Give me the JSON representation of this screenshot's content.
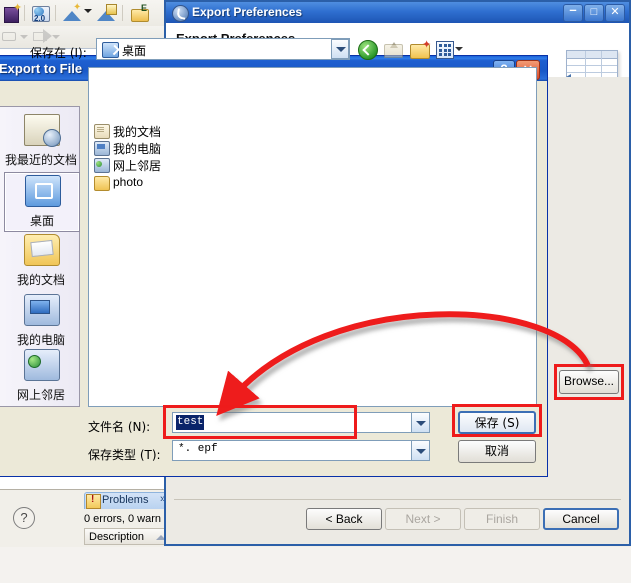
{
  "workbench": {
    "toolbar_icons": [
      "new-wizard-icon",
      "web-browser-icon",
      "new-java-project-icon",
      "new-class-icon",
      "open-type-icon"
    ],
    "nav_icons": [
      "back-arrow-icon",
      "forward-arrow-icon"
    ]
  },
  "problems_view": {
    "tab_label": "Problems",
    "tab_icon": "problems-warning-icon",
    "chevron": "»",
    "summary": "0 errors, 0 warn",
    "column_header": "Description",
    "sort_indicator": "sort-ascending-icon"
  },
  "wizard": {
    "title": "Export Preferences",
    "title_icon": "export-preferences-icon",
    "header_title": "Export Preferences",
    "banner_icon": "export-table-arrow-icon",
    "window_buttons": {
      "minimize": "–",
      "maximize": "□",
      "close": "✕"
    },
    "help_icon": "?",
    "buttons": [
      {
        "label": "< Back",
        "name": "back-button",
        "state": "enabled"
      },
      {
        "label": "Next >",
        "name": "next-button",
        "state": "disabled"
      },
      {
        "label": "Finish",
        "name": "finish-button",
        "state": "disabled"
      },
      {
        "label": "Cancel",
        "name": "cancel-button",
        "state": "default"
      }
    ],
    "browse_label": "Browse..."
  },
  "save_dialog": {
    "title": "Export to File",
    "help_button": "?",
    "close_button": "✕",
    "save_in_label": "保存在 (I):",
    "save_in_value": "桌面",
    "save_in_icon": "desktop-icon",
    "nav_buttons": [
      {
        "name": "back-navigation-icon",
        "label": "back"
      },
      {
        "name": "up-one-level-icon",
        "label": "up"
      },
      {
        "name": "new-folder-icon",
        "label": "new folder"
      },
      {
        "name": "views-icon",
        "label": "views"
      }
    ],
    "files": [
      {
        "label": "我的文档",
        "icon": "my-documents-icon"
      },
      {
        "label": "我的电脑",
        "icon": "my-computer-icon"
      },
      {
        "label": "网上邻居",
        "icon": "network-places-icon"
      },
      {
        "label": "photo",
        "icon": "folder-icon"
      }
    ],
    "places": [
      {
        "label": "我最近的文档",
        "icon": "recent-documents-icon",
        "selected": false
      },
      {
        "label": "桌面",
        "icon": "desktop-icon",
        "selected": true
      },
      {
        "label": "我的文档",
        "icon": "my-documents-icon",
        "selected": false
      },
      {
        "label": "我的电脑",
        "icon": "my-computer-icon",
        "selected": false
      },
      {
        "label": "网上邻居",
        "icon": "network-places-icon",
        "selected": false
      }
    ],
    "file_name_label": "文件名 (N):",
    "file_name_value": "test",
    "file_type_label": "保存类型 (T):",
    "file_type_value": "*. epf",
    "save_button": "保存 (S)",
    "cancel_button": "取消"
  },
  "annotations": {
    "highlight_color": "#ee1b1b",
    "boxes": [
      "file-name-field",
      "save-button",
      "browse-button"
    ],
    "arrows": [
      "browse-to-filename-curve",
      "filename-to-save-arrow"
    ]
  },
  "colors": {
    "title_blue": "#1d55b4",
    "xp_title_blue": "#1e5fd0",
    "selection_blue": "#0a246a",
    "annotation_red": "#ee1b1b",
    "dialog_face": "#ece9d8"
  }
}
